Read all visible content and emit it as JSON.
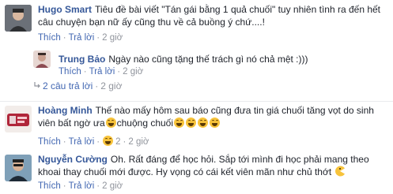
{
  "comments": [
    {
      "name": "Hugo Smart",
      "text": "Tiêu đề bài viết \"Tán gái bằng 1 quả chuối\" tuy nhiên tình ra đến hết câu chuyện bạn nữ ấy cũng thu về cả buồng ý chứ....!",
      "like": "Thích",
      "reply": "Trả lời",
      "time": "2 giờ"
    },
    {
      "name": "Trung Bảo",
      "text": "Ngày nào cũng tặng thế trách gì nó chả mệt :)))",
      "like": "Thích",
      "reply": "Trả lời",
      "time": "2 giờ"
    },
    {
      "name": "Hoàng Minh",
      "text_a": "Thế nào mấy hôm sau báo cũng đưa tin giá chuối tăng vọt do sinh viên bất ngờ ưa",
      "text_b": "chuộng chuối",
      "like": "Thích",
      "reply": "Trả lời",
      "reaction_count": "2",
      "time": "2 giờ"
    },
    {
      "name": "Nguyễn Cường",
      "text": "Oh. Rất đáng để học hỏi. Sắp tới mình đi học phải mang theo khoai thay chuối mới được. Hy vọng có cái kết viên mãn như chủ thớt",
      "like": "Thích",
      "reply": "Trả lời",
      "time": "2 giờ"
    }
  ],
  "replies_link": {
    "label": "2 câu trả lời",
    "time": "2 giờ"
  },
  "colors": {
    "name": "#365899",
    "link": "#4267b2",
    "meta": "#90949c",
    "text": "#1d2129"
  }
}
